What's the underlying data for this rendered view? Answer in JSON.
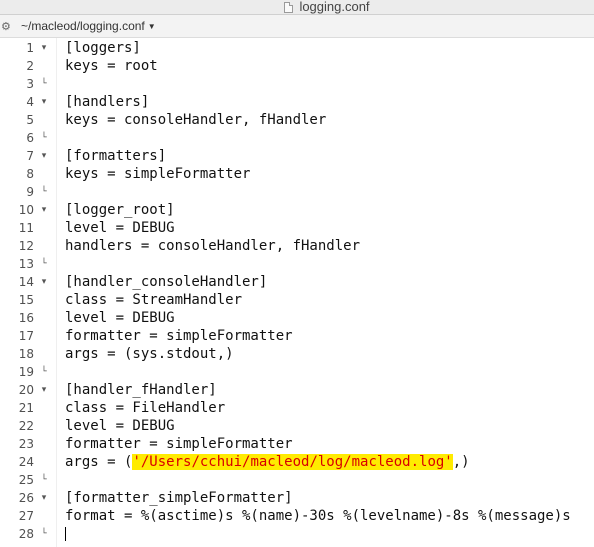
{
  "window": {
    "title": "logging.conf",
    "path": "~/macleod/logging.conf"
  },
  "colors": {
    "string_bg": "#ffeb00",
    "string_fg": "#d80000"
  },
  "lines": [
    {
      "n": "1",
      "fold": "open",
      "text": "[loggers]"
    },
    {
      "n": "2",
      "fold": "",
      "text": "keys = root"
    },
    {
      "n": "3",
      "fold": "end",
      "text": ""
    },
    {
      "n": "4",
      "fold": "open",
      "text": "[handlers]"
    },
    {
      "n": "5",
      "fold": "",
      "text": "keys = consoleHandler, fHandler"
    },
    {
      "n": "6",
      "fold": "end",
      "text": ""
    },
    {
      "n": "7",
      "fold": "open",
      "text": "[formatters]"
    },
    {
      "n": "8",
      "fold": "",
      "text": "keys = simpleFormatter"
    },
    {
      "n": "9",
      "fold": "end",
      "text": ""
    },
    {
      "n": "10",
      "fold": "open",
      "text": "[logger_root]"
    },
    {
      "n": "11",
      "fold": "",
      "text": "level = DEBUG"
    },
    {
      "n": "12",
      "fold": "",
      "text": "handlers = consoleHandler, fHandler"
    },
    {
      "n": "13",
      "fold": "end",
      "text": ""
    },
    {
      "n": "14",
      "fold": "open",
      "text": "[handler_consoleHandler]"
    },
    {
      "n": "15",
      "fold": "",
      "text": "class = StreamHandler"
    },
    {
      "n": "16",
      "fold": "",
      "text": "level = DEBUG"
    },
    {
      "n": "17",
      "fold": "",
      "text": "formatter = simpleFormatter"
    },
    {
      "n": "18",
      "fold": "",
      "text": "args = (sys.stdout,)"
    },
    {
      "n": "19",
      "fold": "end",
      "text": ""
    },
    {
      "n": "20",
      "fold": "open",
      "text": "[handler_fHandler]"
    },
    {
      "n": "21",
      "fold": "",
      "text": "class = FileHandler"
    },
    {
      "n": "22",
      "fold": "",
      "text": "level = DEBUG"
    },
    {
      "n": "23",
      "fold": "",
      "text": "formatter = simpleFormatter"
    },
    {
      "n": "24",
      "fold": "",
      "text": "args = (",
      "string": "'/Users/cchui/macleod/log/macleod.log'",
      "after": ",)"
    },
    {
      "n": "25",
      "fold": "end",
      "text": ""
    },
    {
      "n": "26",
      "fold": "open",
      "text": "[formatter_simpleFormatter]"
    },
    {
      "n": "27",
      "fold": "",
      "text": "format = %(asctime)s %(name)-30s %(levelname)-8s %(message)s"
    },
    {
      "n": "28",
      "fold": "end",
      "text": "",
      "cursor": true
    }
  ]
}
